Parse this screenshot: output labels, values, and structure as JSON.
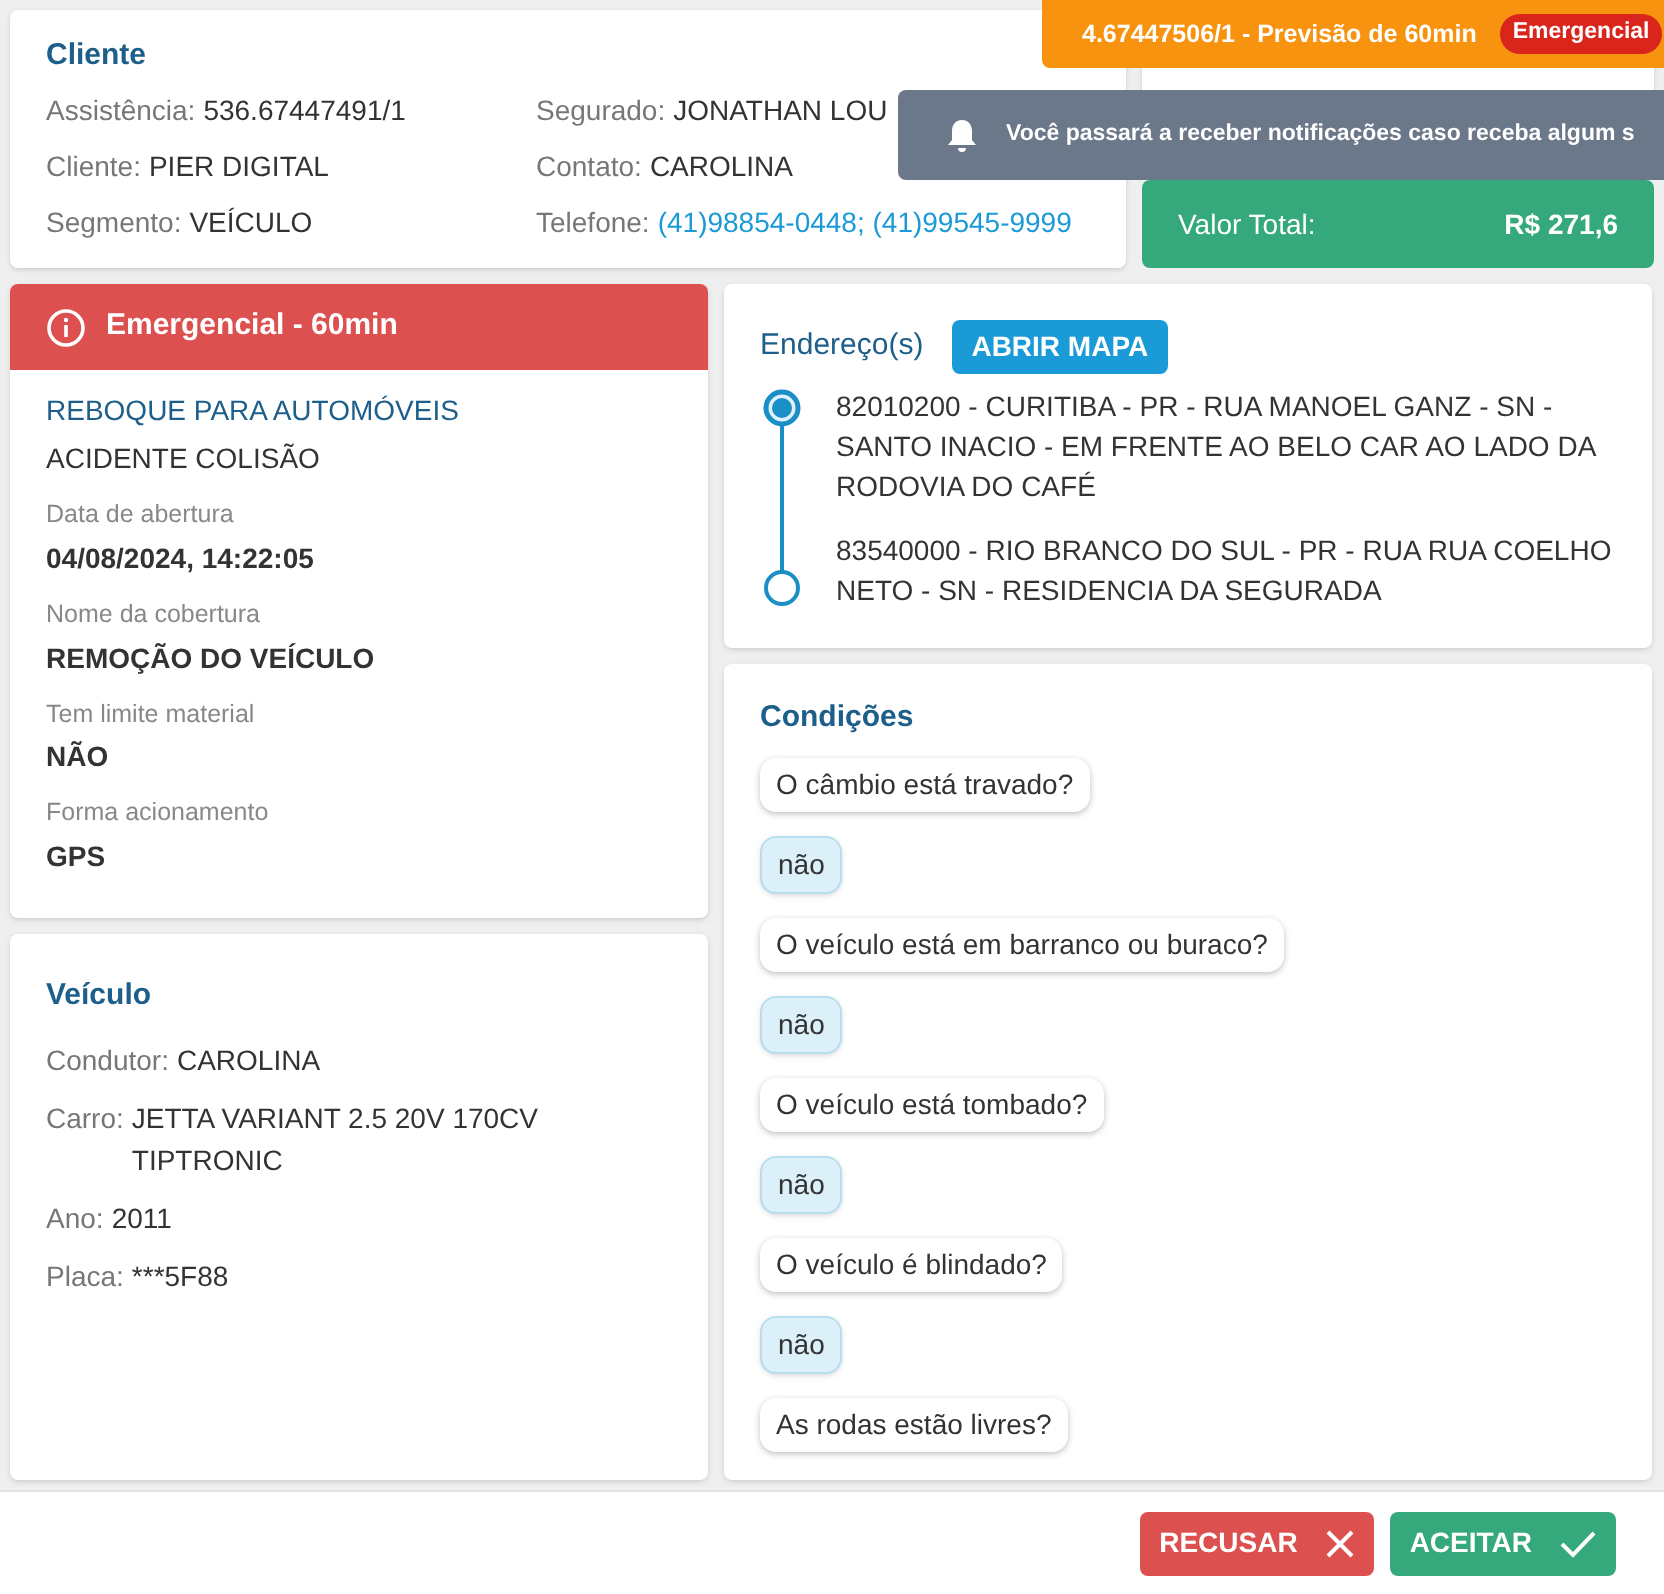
{
  "banner": {
    "text": "4.67447506/1 - Previsão de 60min",
    "badge": "Emergencial"
  },
  "toast": {
    "text": "Você passará a receber notificações caso receba algum s"
  },
  "cliente": {
    "title": "Cliente",
    "fields": [
      {
        "label": "Assistência:",
        "value": "536.67447491/1",
        "kind": "plain"
      },
      {
        "label": "Segurado:",
        "value": "JONATHAN LOU",
        "kind": "plain"
      },
      {
        "label": "Cliente:",
        "value": "PIER DIGITAL",
        "kind": "plain"
      },
      {
        "label": "Contato:",
        "value": "CAROLINA",
        "kind": "plain"
      },
      {
        "label": "Segmento:",
        "value": "VEÍCULO",
        "kind": "plain"
      },
      {
        "label": "Telefone:",
        "value": "(41)98854-0448; (41)99545-9999",
        "kind": "link"
      }
    ]
  },
  "total": {
    "label": "Valor Total:",
    "value": "R$ 271,6"
  },
  "service": {
    "alert": "Emergencial - 60min",
    "title": "REBOQUE PARA AUTOMÓVEIS",
    "subtitle": "ACIDENTE COLISÃO",
    "details": [
      {
        "label": "Data de abertura",
        "value": "04/08/2024, 14:22:05"
      },
      {
        "label": "Nome da cobertura",
        "value": "REMOÇÃO DO VEÍCULO"
      },
      {
        "label": "Tem limite material",
        "value": "NÃO"
      },
      {
        "label": "Forma acionamento",
        "value": "GPS"
      }
    ]
  },
  "veiculo": {
    "title": "Veículo",
    "fields": [
      {
        "label": "Condutor:",
        "value": "CAROLINA"
      },
      {
        "label": "Carro:",
        "value": "JETTA VARIANT 2.5 20V 170CV TIPTRONIC"
      },
      {
        "label": "Ano:",
        "value": "2011"
      },
      {
        "label": "Placa:",
        "value": "***5F88"
      }
    ]
  },
  "enderecos": {
    "title": "Endereço(s)",
    "button": "ABRIR MAPA",
    "items": [
      {
        "text": "82010200 - CURITIBA - PR - RUA MANOEL GANZ - SN - SANTO INACIO - EM FRENTE AO BELO CAR AO LADO DA RODOVIA DO CAFÉ",
        "selected": true
      },
      {
        "text": "83540000 - RIO BRANCO DO SUL - PR - RUA RUA COELHO NETO - SN - RESIDENCIA DA SEGURADA",
        "selected": false
      }
    ]
  },
  "condicoes": {
    "title": "Condições",
    "items": [
      {
        "kind": "question",
        "text": "O câmbio está travado?"
      },
      {
        "kind": "answer",
        "text": "não"
      },
      {
        "kind": "question",
        "text": "O veículo está em barranco ou buraco?"
      },
      {
        "kind": "answer",
        "text": "não"
      },
      {
        "kind": "question",
        "text": "O veículo está tombado?"
      },
      {
        "kind": "answer",
        "text": "não"
      },
      {
        "kind": "question",
        "text": "O veículo é blindado?"
      },
      {
        "kind": "answer",
        "text": "não"
      },
      {
        "kind": "question",
        "text": "As rodas estão livres?"
      }
    ]
  },
  "actions": {
    "reject": "RECUSAR",
    "accept": "ACEITAR"
  }
}
